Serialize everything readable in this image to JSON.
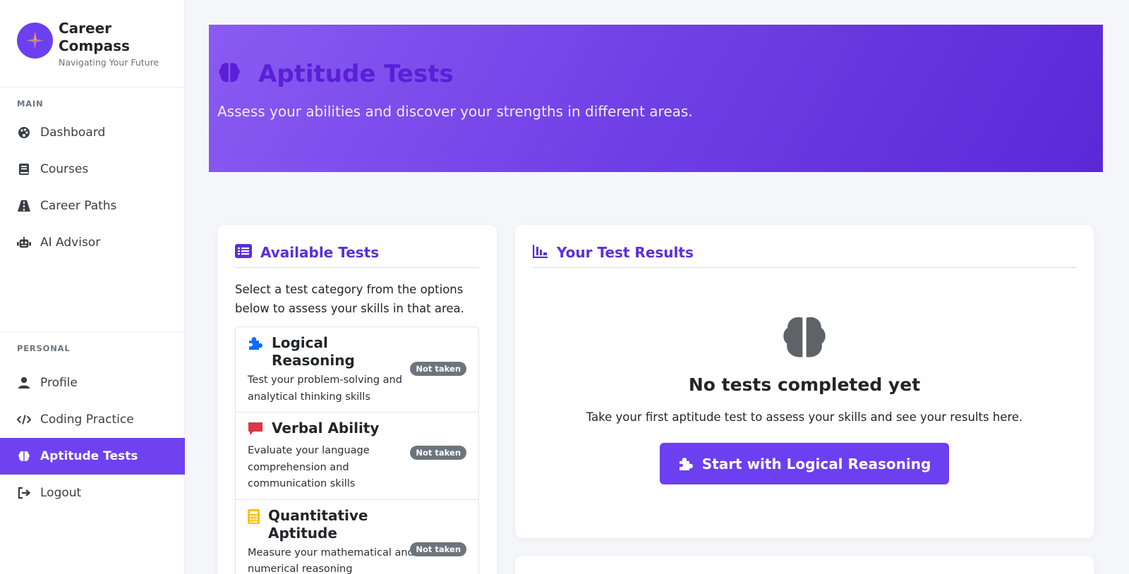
{
  "brand": {
    "title": "Career Compass",
    "subtitle": "Navigating Your Future"
  },
  "sidebar": {
    "main_label": "MAIN",
    "main_items": [
      {
        "label": "Dashboard",
        "icon": "palette-icon"
      },
      {
        "label": "Courses",
        "icon": "book-icon"
      },
      {
        "label": "Career Paths",
        "icon": "road-icon"
      },
      {
        "label": "AI Advisor",
        "icon": "robot-icon"
      }
    ],
    "personal_label": "PERSONAL",
    "personal_items": [
      {
        "label": "Profile",
        "icon": "user-icon"
      },
      {
        "label": "Coding Practice",
        "icon": "code-icon"
      },
      {
        "label": "Aptitude Tests",
        "icon": "brain-icon",
        "active": true
      },
      {
        "label": "Logout",
        "icon": "logout-icon"
      }
    ]
  },
  "hero": {
    "title": "Aptitude Tests",
    "subtitle": "Assess your abilities and discover your strengths in different areas."
  },
  "available": {
    "title": "Available Tests",
    "intro": "Select a test category from the options below to assess your skills in that area.",
    "tests": [
      {
        "name": "Logical Reasoning",
        "desc": "Test your problem-solving and analytical thinking skills",
        "status": "Not taken",
        "icon": "puzzle-icon",
        "color": "#0d6efd"
      },
      {
        "name": "Verbal Ability",
        "desc": "Evaluate your language comprehension and communication skills",
        "status": "Not taken",
        "icon": "comment-icon",
        "color": "#dc3545"
      },
      {
        "name": "Quantitative Aptitude",
        "desc": "Measure your mathematical and numerical reasoning",
        "status": "Not taken",
        "icon": "calculator-icon",
        "color": "#ffc107"
      }
    ]
  },
  "results": {
    "title": "Your Test Results",
    "empty_title": "No tests completed yet",
    "empty_text": "Take your first aptitude test to assess your skills and see your results here.",
    "button_label": "Start with Logical Reasoning"
  },
  "colors": {
    "accent": "#6e42ee",
    "title": "#5c2ed8"
  }
}
